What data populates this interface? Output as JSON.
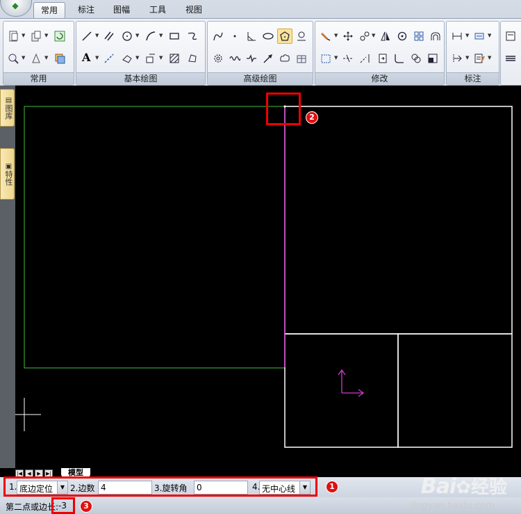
{
  "ribbon": {
    "tabs": [
      {
        "label": "常用",
        "active": true
      },
      {
        "label": "标注",
        "active": false
      },
      {
        "label": "图幅",
        "active": false
      },
      {
        "label": "工具",
        "active": false
      },
      {
        "label": "视图",
        "active": false
      }
    ],
    "panels": {
      "common": "常用",
      "basic_draw": "基本绘图",
      "advanced_draw": "高级绘图",
      "modify": "修改",
      "annotate": "标注"
    },
    "text_tool_glyph": "A"
  },
  "dock": {
    "library_tab": "图库",
    "properties_tab": "特性"
  },
  "sheet": {
    "active_tab": "模型"
  },
  "options": {
    "opt1_label": "1.",
    "opt1_value": "底边定位",
    "opt2_label": "2.边数",
    "opt2_value": "4",
    "opt3_label": "3.旋转角",
    "opt3_value": "0",
    "opt4_label": "4.",
    "opt4_value": "无中心线"
  },
  "status": {
    "prompt": "第二点或边长:",
    "input": "-3"
  },
  "annotations": {
    "badge1": "1",
    "badge2": "2",
    "badge3": "3"
  },
  "watermark": {
    "brand": "Bai",
    "brand2": "经验",
    "url": "jingyan.baidu.com"
  },
  "colors": {
    "green_rect": "#3fbf3f",
    "white_lines": "#ffffff",
    "magenta": "#d23ad2",
    "highlight": "#fbe39a",
    "annotation_red": "#e00000"
  }
}
